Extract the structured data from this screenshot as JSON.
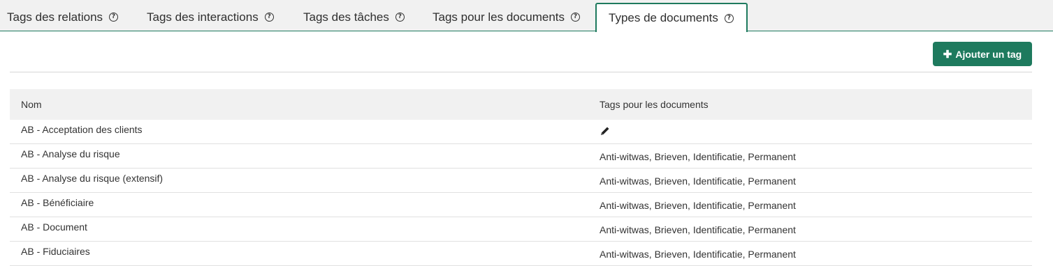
{
  "tabs": [
    {
      "label": "Tags des relations"
    },
    {
      "label": "Tags des interactions"
    },
    {
      "label": "Tags des tâches"
    },
    {
      "label": "Tags pour les documents"
    },
    {
      "label": "Types de documents",
      "active": true
    }
  ],
  "help_glyph": "?",
  "toolbar": {
    "add_label": "Ajouter un tag",
    "add_icon": "plus-icon",
    "plus_glyph": "✚"
  },
  "table": {
    "headers": {
      "name": "Nom",
      "tags": "Tags pour les documents"
    },
    "rows": [
      {
        "name": "AB - Acceptation des clients",
        "tags": "",
        "edit_icon": "pencil-icon"
      },
      {
        "name": "AB - Analyse du risque",
        "tags": "Anti-witwas, Brieven, Identificatie, Permanent"
      },
      {
        "name": "AB - Analyse du risque (extensif)",
        "tags": "Anti-witwas, Brieven, Identificatie, Permanent"
      },
      {
        "name": "AB - Bénéficiaire",
        "tags": "Anti-witwas, Brieven, Identificatie, Permanent"
      },
      {
        "name": "AB - Document",
        "tags": "Anti-witwas, Brieven, Identificatie, Permanent"
      },
      {
        "name": "AB - Fiduciaires",
        "tags": "Anti-witwas, Brieven, Identificatie, Permanent"
      }
    ]
  },
  "colors": {
    "accent": "#1e7a5e",
    "header_bg": "#f1f1f1"
  }
}
